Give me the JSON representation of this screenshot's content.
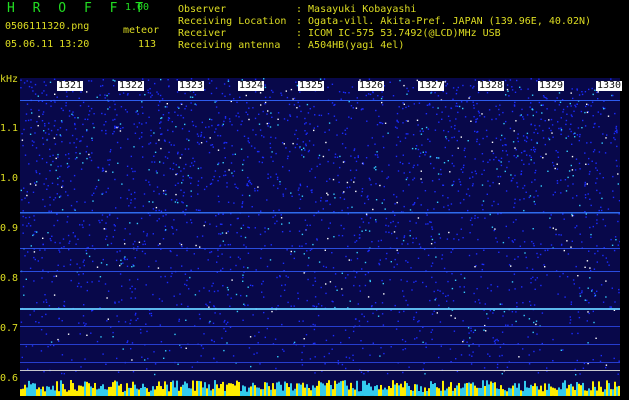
{
  "header": {
    "app_title": "H R O F F T",
    "app_version": "1.00",
    "filename": "0506111320.png",
    "mode": "meteor",
    "datetime": "05.06.11 13:20",
    "count": "113"
  },
  "info": [
    {
      "label": "Observer",
      "value": ": Masayuki Kobayashi"
    },
    {
      "label": "Receiving Location",
      "value": ": Ogata-vill. Akita-Pref. JAPAN (139.96E, 40.02N)"
    },
    {
      "label": "Receiver",
      "value": ": ICOM IC-575 53.7492(@LCD)MHz USB"
    },
    {
      "label": "Receiving antenna",
      "value": ": A504HB(yagi 4el)"
    }
  ],
  "axis": {
    "y_unit": "kHz",
    "y_ticks": [
      "1.1",
      "1.0",
      "0.9",
      "0.8",
      "0.7",
      "0.6"
    ],
    "x_ticks": [
      "1321",
      "1322",
      "1323",
      "1324",
      "1325",
      "1326",
      "1327",
      "1328",
      "1329",
      "1330"
    ]
  },
  "colors": {
    "background": "#000000",
    "header_green": "#22dd22",
    "text_yellow": "#dddd22",
    "noise_blue": "#1a2cff",
    "noise_cyan": "#33ccff",
    "bar_cyan": "#33ccee",
    "bar_yellow": "#ffee00"
  }
}
